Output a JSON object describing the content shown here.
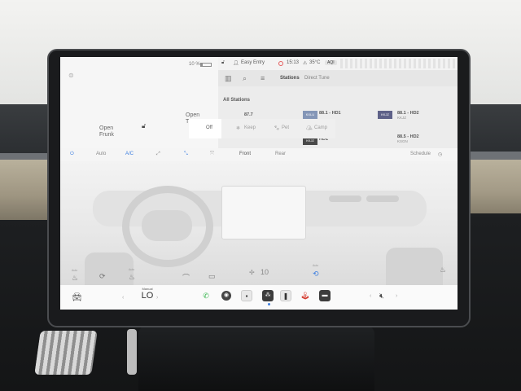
{
  "status": {
    "battery": "10 %",
    "profile": "Easy Entry",
    "time": "15:13",
    "temperature": "35°C",
    "aqi": "AQI"
  },
  "car": {
    "frunk_open": "Open",
    "frunk_label": "Frunk",
    "trunk_open": "Open",
    "trunk_label": "Tr"
  },
  "media": {
    "tabs": [
      "Stations",
      "Direct Tune"
    ],
    "section": "All Stations",
    "stations": [
      {
        "freq": "87.7",
        "sub": ""
      },
      {
        "freq": "88.1 - HD1",
        "sub": ""
      },
      {
        "freq": "88.1 - HD2",
        "sub": "KKJZ"
      },
      {
        "freq": "HD1",
        "sub": ""
      },
      {
        "freq": "88.5 - HD2",
        "sub": "KSGN"
      }
    ],
    "logos": [
      "KKJZ",
      "KXLU",
      "KKJZ"
    ]
  },
  "climate_modes": {
    "off": "Off",
    "keep": "Keep",
    "pet": "Pet",
    "camp": "Camp"
  },
  "climate": {
    "auto": "Auto",
    "ac": "A/C",
    "front": "Front",
    "rear": "Rear",
    "schedule": "Schedule"
  },
  "interior": {
    "fan_speed": "10",
    "labels": [
      "Auto",
      "Auto",
      "Auto"
    ]
  },
  "dock": {
    "temp_mode": "Manual",
    "temp_value": "LO"
  },
  "colors": {
    "accent": "#3d7fe0",
    "phone": "#33b44a",
    "record": "#e03a3a"
  }
}
